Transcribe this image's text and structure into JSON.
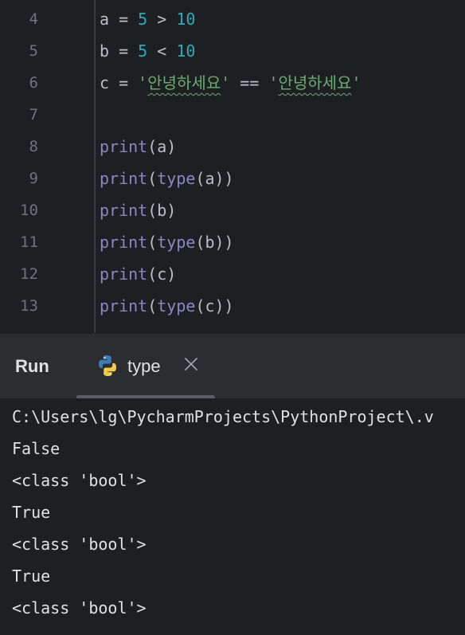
{
  "editor": {
    "lines": [
      {
        "num": "4",
        "tokens": [
          [
            "op",
            "a = "
          ],
          [
            "num",
            "5"
          ],
          [
            "op",
            " > "
          ],
          [
            "num",
            "10"
          ]
        ]
      },
      {
        "num": "5",
        "tokens": [
          [
            "op",
            "b = "
          ],
          [
            "num",
            "5"
          ],
          [
            "op",
            " < "
          ],
          [
            "num",
            "10"
          ]
        ]
      },
      {
        "num": "6",
        "tokens": [
          [
            "op",
            "c = "
          ],
          [
            "str",
            "'"
          ],
          [
            "strkr",
            "안녕하세요"
          ],
          [
            "str",
            "'"
          ],
          [
            "op",
            " == "
          ],
          [
            "str",
            "'"
          ],
          [
            "strkr",
            "안녕하세요"
          ],
          [
            "str",
            "'"
          ]
        ]
      },
      {
        "num": "7",
        "tokens": []
      },
      {
        "num": "8",
        "tokens": [
          [
            "kw",
            "print"
          ],
          [
            "op",
            "(a)"
          ]
        ]
      },
      {
        "num": "9",
        "tokens": [
          [
            "kw",
            "print"
          ],
          [
            "op",
            "("
          ],
          [
            "kw",
            "type"
          ],
          [
            "op",
            "(a))"
          ]
        ]
      },
      {
        "num": "10",
        "tokens": [
          [
            "kw",
            "print"
          ],
          [
            "op",
            "(b)"
          ]
        ]
      },
      {
        "num": "11",
        "tokens": [
          [
            "kw",
            "print"
          ],
          [
            "op",
            "("
          ],
          [
            "kw",
            "type"
          ],
          [
            "op",
            "(b))"
          ]
        ]
      },
      {
        "num": "12",
        "tokens": [
          [
            "kw",
            "print"
          ],
          [
            "op",
            "(c)"
          ]
        ]
      },
      {
        "num": "13",
        "tokens": [
          [
            "kw",
            "print"
          ],
          [
            "op",
            "("
          ],
          [
            "kw",
            "type"
          ],
          [
            "op",
            "(c))"
          ]
        ]
      }
    ]
  },
  "run_panel": {
    "title": "Run",
    "tab_label": "type",
    "tab_icon": "python-icon",
    "close_icon": "close-icon"
  },
  "console": {
    "lines": [
      "C:\\Users\\lg\\PycharmProjects\\PythonProject\\.v",
      "False",
      "<class 'bool'>",
      "True",
      "<class 'bool'>",
      "True",
      "<class 'bool'>"
    ]
  },
  "colors": {
    "background": "#1e1f22",
    "panel": "#2b2d30",
    "number": "#2aacb8",
    "keyword": "#8888c6",
    "string": "#6aab73",
    "text": "#bcbec4"
  }
}
